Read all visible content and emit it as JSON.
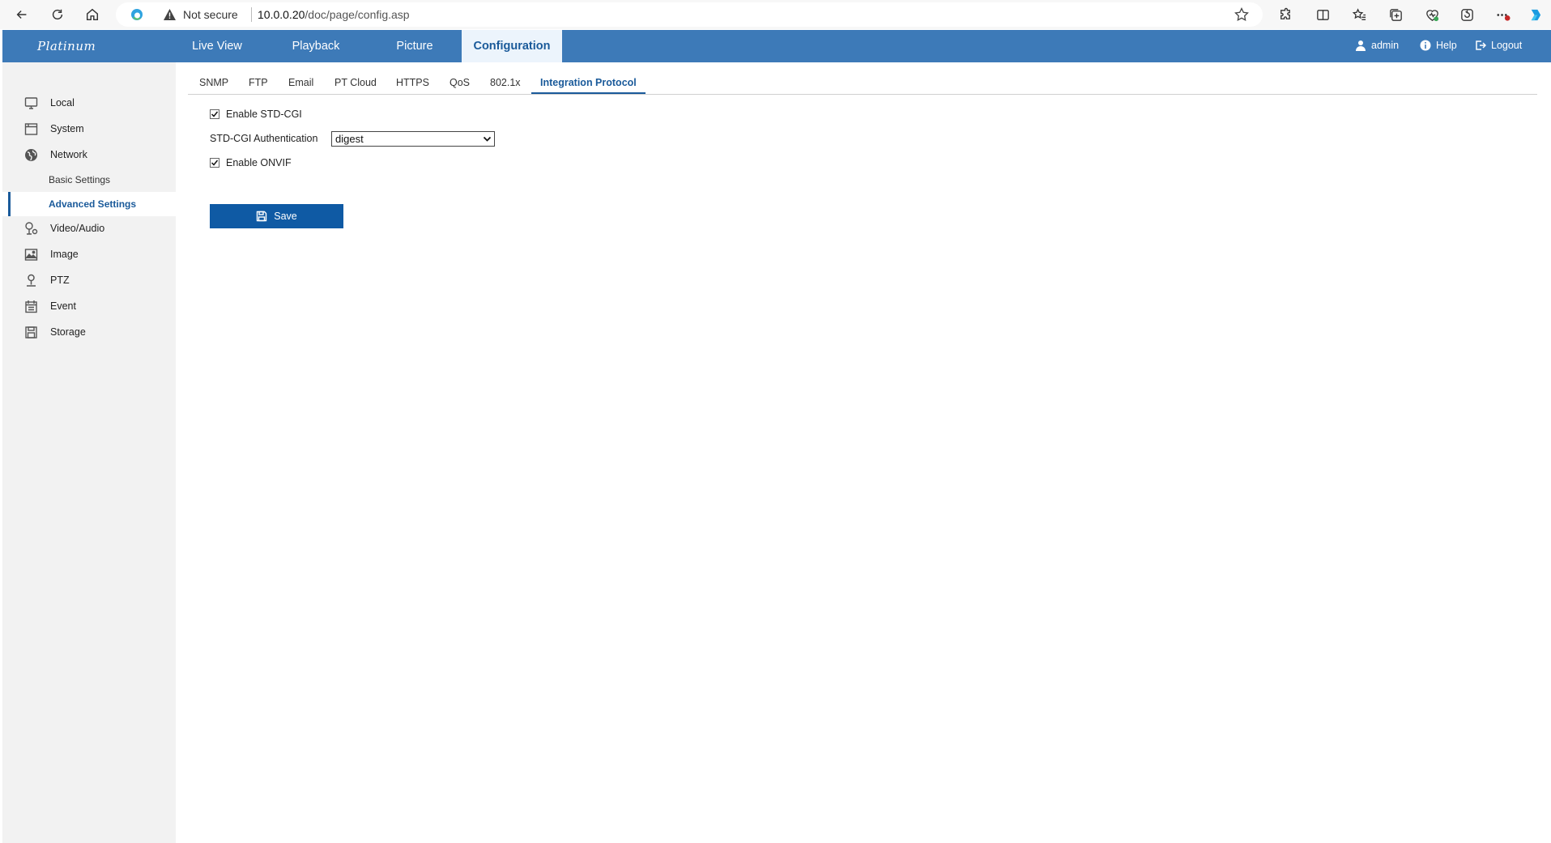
{
  "browser": {
    "security_label": "Not secure",
    "url_host": "10.0.0.20",
    "url_path": "/doc/page/config.asp"
  },
  "header": {
    "brand": "Platinum",
    "tabs": [
      "Live View",
      "Playback",
      "Picture",
      "Configuration"
    ],
    "active_tab": "Configuration",
    "user": "admin",
    "help": "Help",
    "logout": "Logout"
  },
  "sidebar": {
    "items": [
      {
        "label": "Local",
        "icon": "monitor-icon"
      },
      {
        "label": "System",
        "icon": "system-window-icon"
      },
      {
        "label": "Network",
        "icon": "globe-icon"
      },
      {
        "label": "Video/Audio",
        "icon": "microphone-icon"
      },
      {
        "label": "Image",
        "icon": "image-icon"
      },
      {
        "label": "PTZ",
        "icon": "ptz-camera-icon"
      },
      {
        "label": "Event",
        "icon": "calendar-icon"
      },
      {
        "label": "Storage",
        "icon": "storage-icon"
      }
    ],
    "network_sub": [
      "Basic Settings",
      "Advanced Settings"
    ],
    "active_sub": "Advanced Settings"
  },
  "sub_tabs": [
    "SNMP",
    "FTP",
    "Email",
    "PT Cloud",
    "HTTPS",
    "QoS",
    "802.1x",
    "Integration Protocol"
  ],
  "active_sub_tab": "Integration Protocol",
  "form": {
    "enable_std_cgi_label": "Enable STD-CGI",
    "enable_std_cgi_checked": true,
    "auth_label": "STD-CGI Authentication",
    "auth_value": "digest",
    "enable_onvif_label": "Enable ONVIF",
    "enable_onvif_checked": true,
    "save_label": "Save"
  },
  "colors": {
    "header_bg": "#3d7ab8",
    "active_tab_bg": "#ecf4fc",
    "accent": "#1a5a9a",
    "save_bg": "#0f5aa4",
    "sidebar_bg": "#f2f2f2"
  }
}
